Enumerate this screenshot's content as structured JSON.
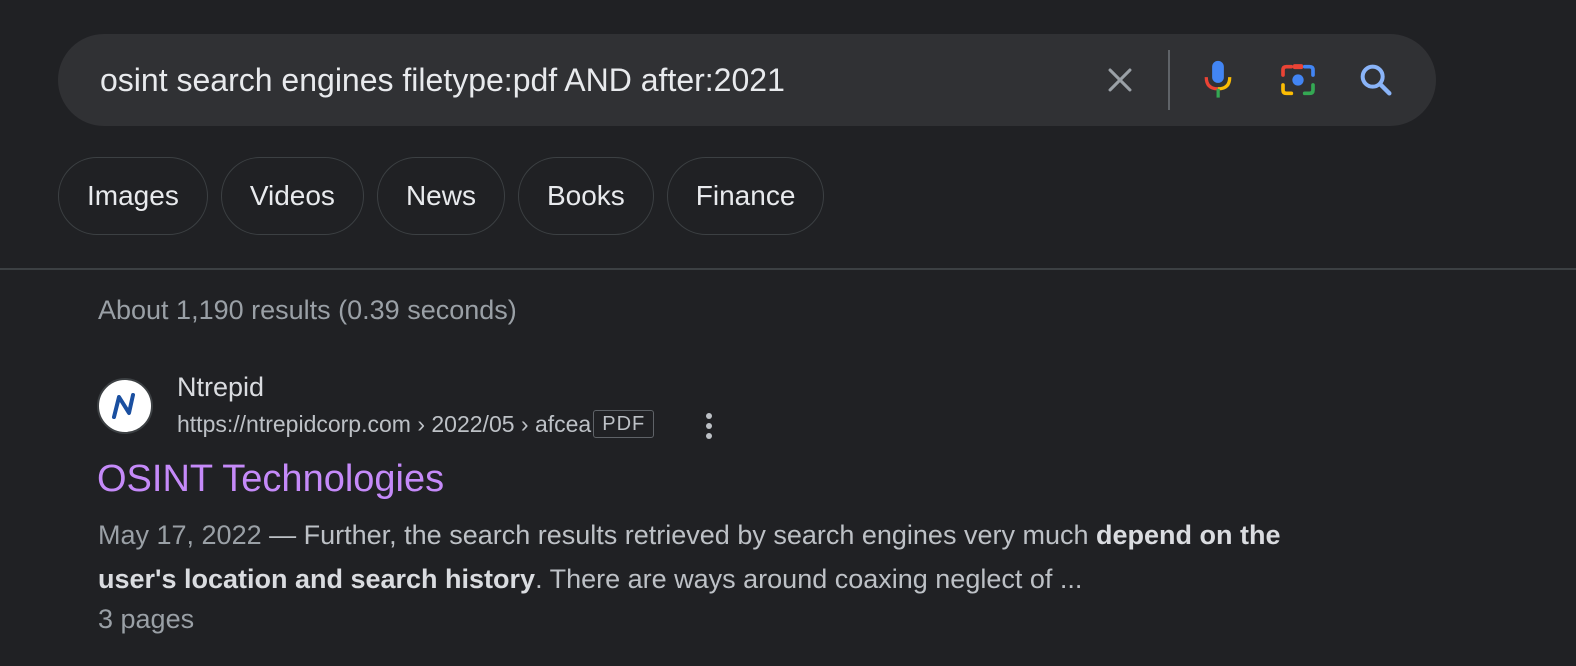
{
  "search": {
    "query": "osint search engines filetype:pdf AND after:2021",
    "clear_icon": "close-icon",
    "mic_icon": "mic-icon",
    "lens_icon": "camera-lens-icon",
    "search_icon": "search-icon"
  },
  "chips": [
    {
      "label": "Images"
    },
    {
      "label": "Videos"
    },
    {
      "label": "News"
    },
    {
      "label": "Books"
    },
    {
      "label": "Finance"
    }
  ],
  "result_stats": "About 1,190 results (0.39 seconds)",
  "results": [
    {
      "site_name": "Ntrepid",
      "url": "https://ntrepidcorp.com › 2022/05 › afcea",
      "badge": "PDF",
      "title": "OSINT Technologies",
      "date": "May 17, 2022",
      "dash": " — ",
      "snippet_1": "Further, the search results retrieved by search engines very much ",
      "snippet_bold": "depend on the user's location and search history",
      "snippet_2": ". There are ways around coaxing neglect of ...",
      "pages": "3 pages"
    }
  ],
  "colors": {
    "background": "#202124",
    "search_bg": "#303134",
    "visited_link": "#c58af9",
    "muted_text": "#9aa0a6"
  }
}
